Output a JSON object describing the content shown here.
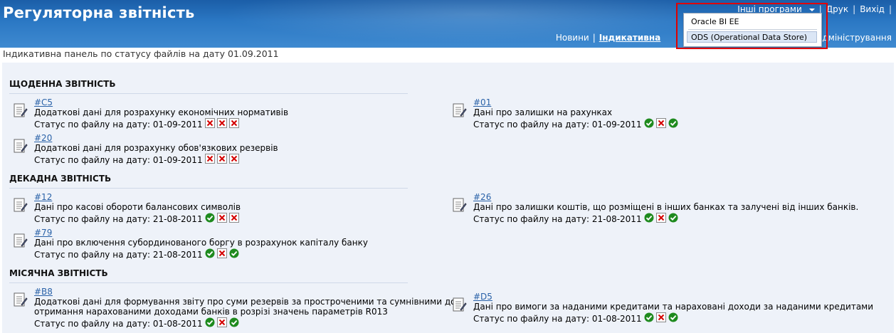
{
  "header": {
    "title": "Регуляторна звітність",
    "other_programs": "Інші програми",
    "print": "Друк",
    "exit": "Вихід",
    "tabs": [
      "Новини",
      "Індикативна",
      "Адміністрування"
    ]
  },
  "dropdown": {
    "options": [
      "Oracle BI EE",
      "ODS (Operational Data Store)"
    ]
  },
  "subtitle": "Індикативна панель по статусу файлів на дату 01.09.2011",
  "sections": [
    {
      "title": "ЩОДЕННА ЗВІТНІСТЬ",
      "items": [
        {
          "code": "#C5",
          "desc": "Додаткові дані для розрахунку економічних нормативів",
          "desc2": "",
          "status_label": "Статус по файлу на дату: 01-09-2011",
          "icons": [
            "fail",
            "fail",
            "fail"
          ]
        },
        {
          "code": "#01",
          "desc": "Дані про залишки на рахунках",
          "desc2": "",
          "status_label": "Статус по файлу на дату: 01-09-2011",
          "icons": [
            "ok",
            "fail",
            "ok"
          ]
        },
        {
          "code": "#20",
          "desc": "Додаткові дані для розрахунку обов'язкових резервів",
          "desc2": "",
          "status_label": "Статус по файлу на дату: 01-09-2011",
          "icons": [
            "fail",
            "fail",
            "fail"
          ]
        }
      ]
    },
    {
      "title": "ДЕКАДНА ЗВІТНІСТЬ",
      "items": [
        {
          "code": "#12",
          "desc": "Дані про касові обороти балансових символів",
          "desc2": "",
          "status_label": "Статус по файлу на дату: 21-08-2011",
          "icons": [
            "ok",
            "fail",
            "fail"
          ]
        },
        {
          "code": "#26",
          "desc": "Дані про залишки коштів, що розміщені в інших банках та залучені від інших банків.",
          "desc2": "",
          "status_label": "Статус по файлу на дату: 21-08-2011",
          "icons": [
            "ok",
            "fail",
            "ok"
          ]
        },
        {
          "code": "#79",
          "desc": "Дані про включення субординованого боргу в розрахунок капіталу банку",
          "desc2": "",
          "status_label": "Статус по файлу на дату: 21-08-2011",
          "icons": [
            "ok",
            "fail",
            "ok"
          ]
        }
      ]
    },
    {
      "title": "МІСЯЧНА ЗВІТНІСТЬ",
      "items": [
        {
          "code": "#B8",
          "desc": "Додаткові дані для формування звіту про суми резервів за простроченими та сумнівними до",
          "desc2": "отримання нарахованими доходами банків в розрізі значень параметрів R013",
          "status_label": "Статус по файлу на дату: 01-08-2011",
          "icons": [
            "ok",
            "fail",
            "ok"
          ]
        },
        {
          "code": "#D5",
          "desc": "Дані про вимоги за наданими кредитами та нараховані доходи за наданими кредитами",
          "desc2": "",
          "status_label": "Статус по файлу на дату: 01-08-2011",
          "icons": [
            "ok",
            "fail",
            "ok"
          ]
        }
      ]
    }
  ]
}
